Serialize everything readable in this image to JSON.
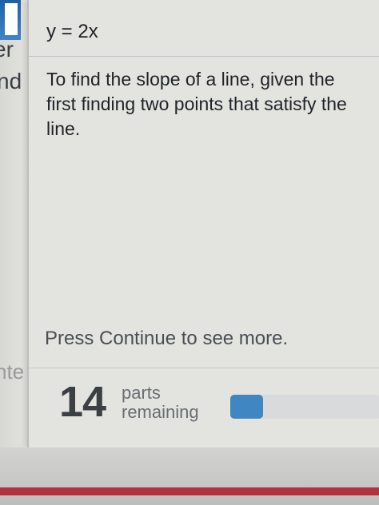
{
  "left_fragments": {
    "top": "er",
    "middle": "nd",
    "bottom": "nte"
  },
  "question": {
    "equation": "y = 2x"
  },
  "explanation": {
    "lines": [
      "To find the slope of a line, given the",
      "first finding two points that satisfy the",
      "line."
    ]
  },
  "continue_message": "Press Continue to see more.",
  "progress": {
    "parts_count": "14",
    "parts_label_line1": "parts",
    "parts_label_line2": "remaining",
    "fill_fraction": 0.22
  },
  "colors": {
    "accent": "#3f86c2",
    "bottom_stripe": "#b4323e"
  }
}
